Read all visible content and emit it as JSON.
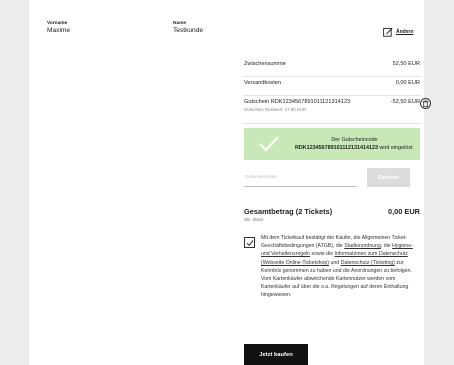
{
  "personal": {
    "firstname_label": "Vorname",
    "firstname_value": "Maxime",
    "lastname_label": "Name",
    "lastname_value": "Testkunde",
    "edit_label": "Ändern"
  },
  "summary": {
    "subtotal_label": "Zwischensumme",
    "subtotal_value": "52,50 EUR",
    "shipping_label": "Versandkosten",
    "shipping_value": "0,00 EUR",
    "coupon_label": "Gutschein RDK12345678910111213141​23",
    "coupon_rest": "Gutschein Restwert: 47,50 EUR",
    "coupon_value": "-52,50 EUR"
  },
  "notice": {
    "line1": "Der Gutscheincode",
    "code": "RDK123456789101112131414123",
    "line2_suffix": " wird eingelöst."
  },
  "coupon_form": {
    "placeholder": "Gutscheincode",
    "apply_label": "Einlösen"
  },
  "total": {
    "label": "Gesamtbetrag (2 Tickets)",
    "sub": "inkl. MwSt.",
    "value": "0,00 EUR"
  },
  "terms": {
    "t1": "Mit dem Ticketkauf bestätigt der Käufer, die Allgemeinen Ticket-Geschäftsbedingungen (ATGB), die ",
    "l1": "Stadionordnung",
    "t2": ", die ",
    "l2": "Hygiene- und Verhaltensregeln",
    "t3": " sowie die ",
    "l3": "Informationen zum Datenschutz (Webseite Online-Ticketshop)",
    "t4": " und ",
    "l4": "Datenschutz (Ticketing)",
    "t5": " zur Kenntnis genommen zu haben und die Anordnungen zu befolgen. Vom Kartenkäufer abweichende Kartennutzer werden vom Kartenkäufer auf über die o.a. Regelungen auf deren Einhaltung hingewiesen."
  },
  "buy_label": "Jetzt kaufen",
  "colors": {
    "success_bg": "#c8e8b8",
    "button_dark": "#111111"
  }
}
